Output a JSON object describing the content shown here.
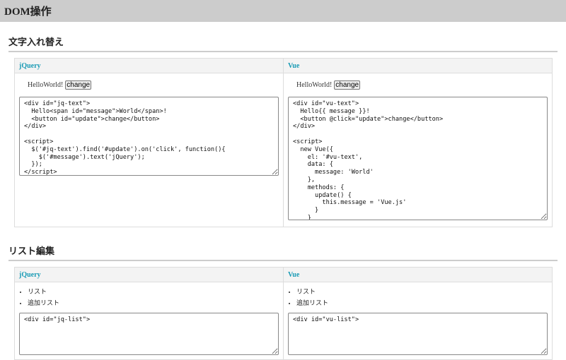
{
  "page_title": "DOM操作",
  "sections": [
    {
      "title": "文字入れ替え",
      "columns": [
        {
          "header": "jQuery",
          "hello": "HelloWorld!",
          "button": "change",
          "code": "<div id=\"jq-text\">\n  Hello<span id=\"message\">World</span>!\n  <button id=\"update\">change</button>\n</div>\n\n<script>\n  $('#jq-text').find('#update').on('click', function(){\n    $('#message').text('jQuery');\n  });\n</script>"
        },
        {
          "header": "Vue",
          "hello": "HelloWorld!",
          "button": "change",
          "code": "<div id=\"vu-text\">\n  Hello{{ message }}!\n  <button @click=\"update\">change</button>\n</div>\n\n<script>\n  new Vue({\n    el: '#vu-text',\n    data: {\n      message: 'World'\n    },\n    methods: {\n      update() {\n        this.message = 'Vue.js'\n      }\n    }\n  });\n</script>"
        }
      ]
    },
    {
      "title": "リスト編集",
      "columns": [
        {
          "header": "jQuery",
          "items": [
            "リスト",
            "追加リスト"
          ],
          "code": "<div id=\"jq-list\">"
        },
        {
          "header": "Vue",
          "items": [
            "リスト",
            "追加リスト"
          ],
          "code": "<div id=\"vu-list\">"
        }
      ]
    }
  ]
}
